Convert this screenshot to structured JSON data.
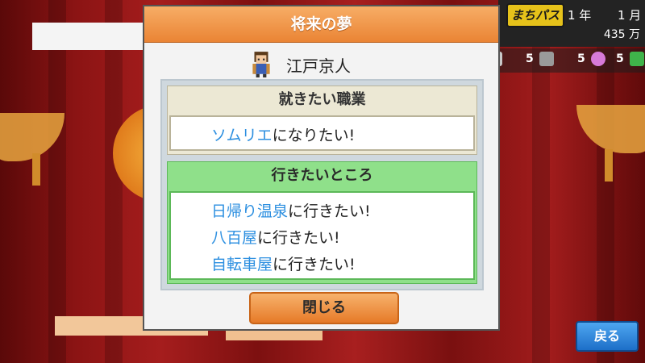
{
  "hud": {
    "pass_label": "まちパス",
    "year": "1 年",
    "month": "1 月",
    "money": "435 万",
    "stats": [
      {
        "value": "5",
        "icon": "vase-icon"
      },
      {
        "value": "5",
        "icon": "box-icon"
      },
      {
        "value": "5",
        "icon": "music-note-icon"
      },
      {
        "value": "5",
        "icon": "book-icon"
      }
    ]
  },
  "dialog": {
    "title": "将来の夢",
    "character_name": "江戸京人",
    "job_section": {
      "header": "就きたい職業",
      "dream_job": "ソムリエ",
      "suffix": "になりたい!"
    },
    "place_section": {
      "header": "行きたいところ",
      "suffix": "に行きたい!",
      "places": [
        "日帰り温泉",
        "八百屋",
        "自転車屋"
      ]
    },
    "close_label": "閉じる"
  },
  "back_label": "戻る",
  "colors": {
    "title_orange": "#ea8434",
    "highlight_blue": "#2c8fe0",
    "section_green": "#8fe08a",
    "back_blue": "#1d6fc8"
  }
}
